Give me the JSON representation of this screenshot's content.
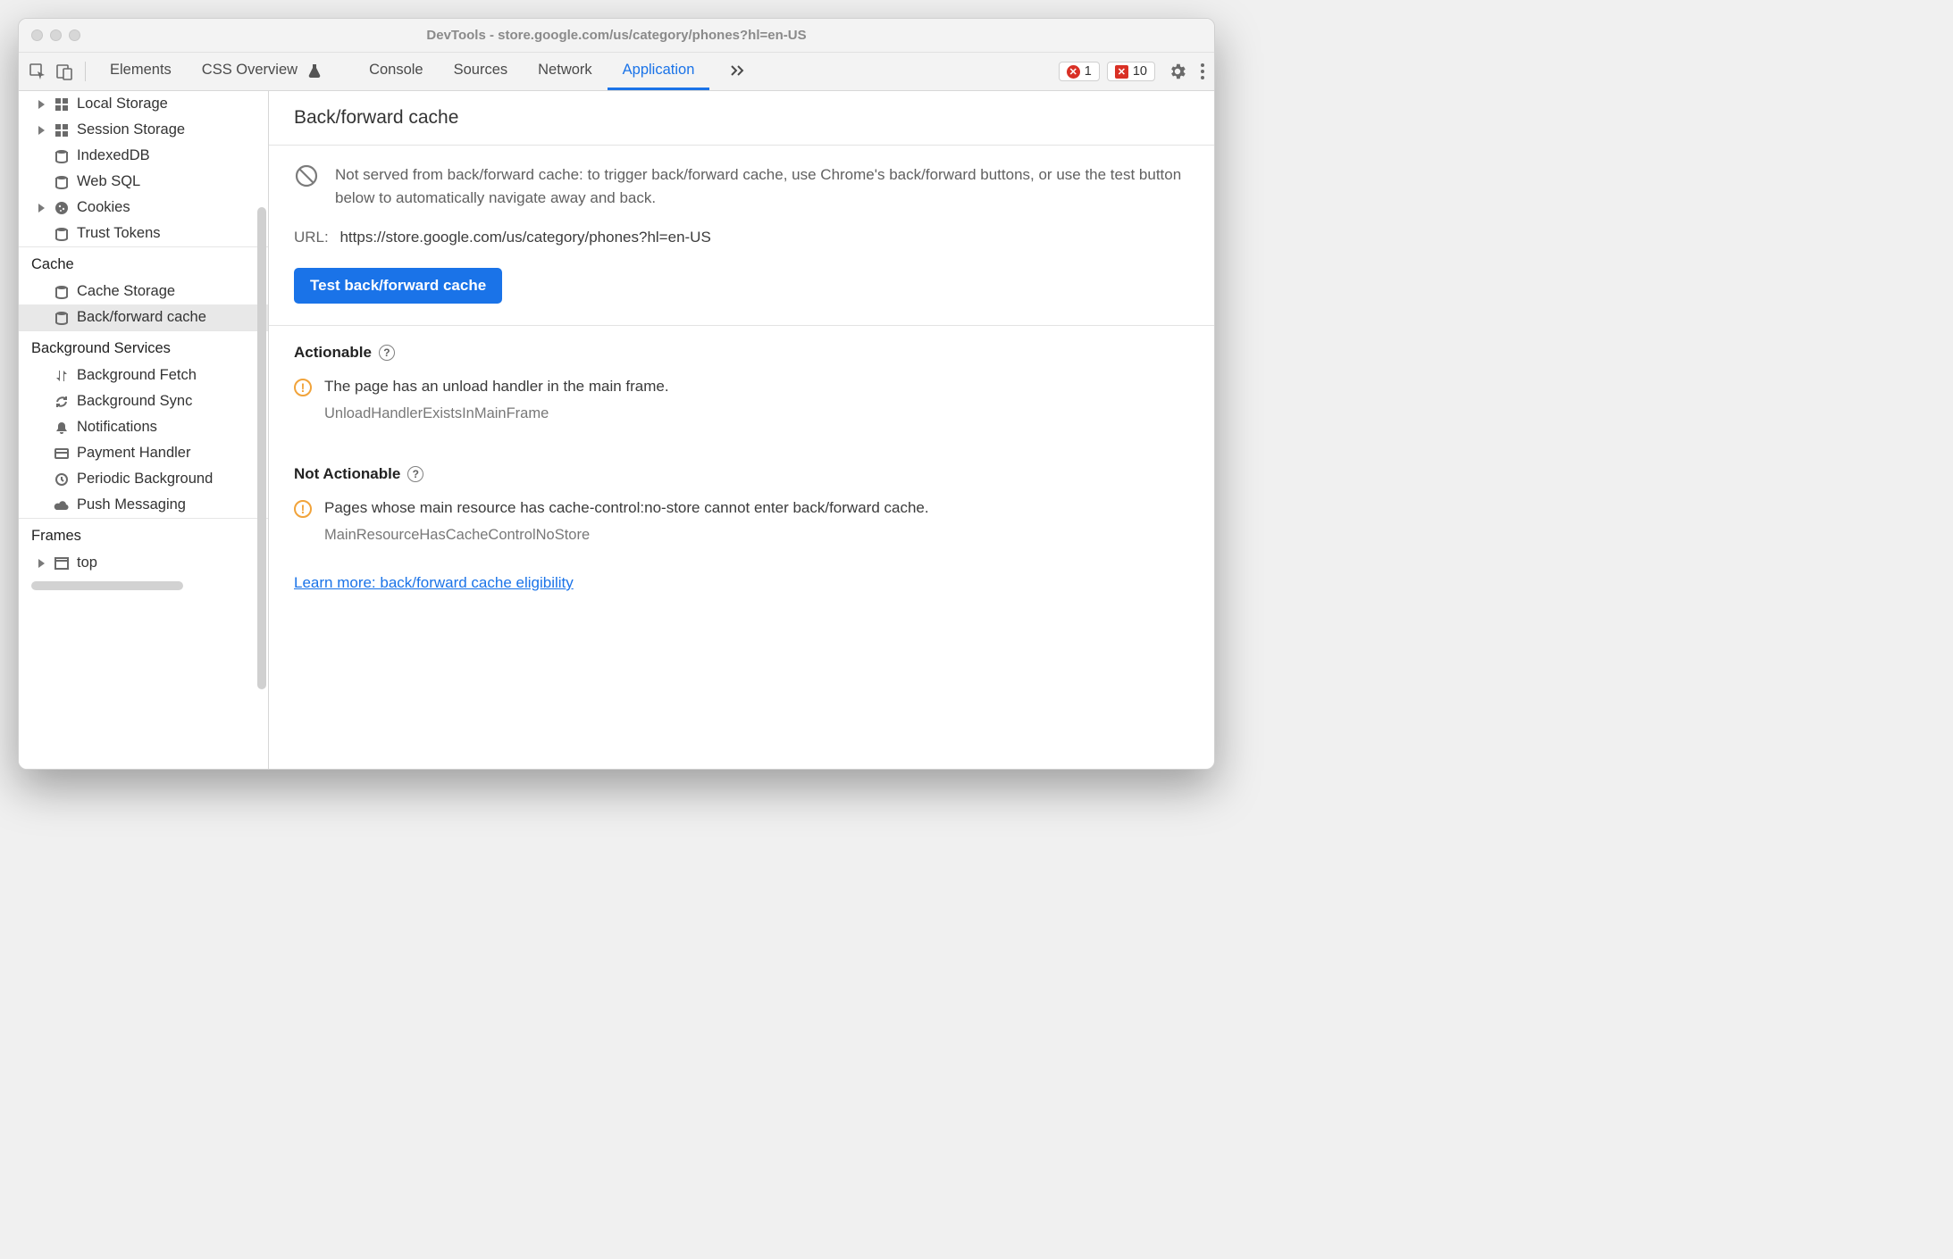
{
  "window": {
    "title": "DevTools - store.google.com/us/category/phones?hl=en-US"
  },
  "tabs": {
    "elements": "Elements",
    "css_overview": "CSS Overview",
    "console": "Console",
    "sources": "Sources",
    "network": "Network",
    "application": "Application"
  },
  "toolbar": {
    "error_count": "1",
    "issue_count": "10"
  },
  "sidebar": {
    "storage": {
      "local_storage": "Local Storage",
      "session_storage": "Session Storage",
      "indexeddb": "IndexedDB",
      "web_sql": "Web SQL",
      "cookies": "Cookies",
      "trust_tokens": "Trust Tokens"
    },
    "cache": {
      "header": "Cache",
      "cache_storage": "Cache Storage",
      "bf_cache": "Back/forward cache"
    },
    "bg": {
      "header": "Background Services",
      "fetch": "Background Fetch",
      "sync": "Background Sync",
      "notifications": "Notifications",
      "payment": "Payment Handler",
      "periodic": "Periodic Background",
      "push": "Push Messaging"
    },
    "frames": {
      "header": "Frames",
      "top": "top"
    }
  },
  "main": {
    "title": "Back/forward cache",
    "info": "Not served from back/forward cache: to trigger back/forward cache, use Chrome's back/forward buttons, or use the test button below to automatically navigate away and back.",
    "url_label": "URL:",
    "url_value": "https://store.google.com/us/category/phones?hl=en-US",
    "test_btn": "Test back/forward cache",
    "actionable_h": "Actionable",
    "actionable_msg": "The page has an unload handler in the main frame.",
    "actionable_code": "UnloadHandlerExistsInMainFrame",
    "not_actionable_h": "Not Actionable",
    "not_actionable_msg": "Pages whose main resource has cache-control:no-store cannot enter back/forward cache.",
    "not_actionable_code": "MainResourceHasCacheControlNoStore",
    "learn_more": "Learn more: back/forward cache eligibility"
  }
}
